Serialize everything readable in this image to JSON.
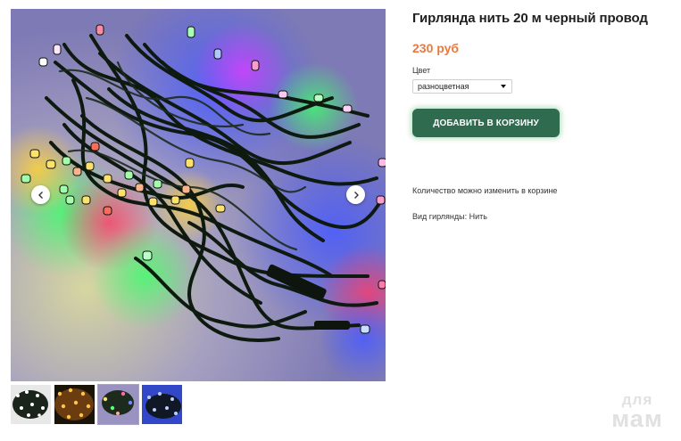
{
  "product": {
    "title": "Гирлянда нить 20 м черный провод",
    "price": "230 руб"
  },
  "option": {
    "label": "Цвет",
    "selected": "разноцветная"
  },
  "buttons": {
    "add_to_cart": "ДОБАВИТЬ В КОРЗИНУ"
  },
  "info": {
    "quantity_note": "Количество можно изменить в корзине",
    "attribute": "Вид гирлянды: Нить"
  },
  "gallery": {
    "thumbnail_count": 4,
    "active_thumbnail": 3
  },
  "watermark": {
    "line1": "для",
    "line2": "мам"
  },
  "icons": {
    "prev": "chevron-left-icon",
    "next": "chevron-right-icon"
  },
  "colors": {
    "price": "#e9793f",
    "cart_button": "#2e6b4f",
    "cart_button_glow": "#82c896"
  }
}
